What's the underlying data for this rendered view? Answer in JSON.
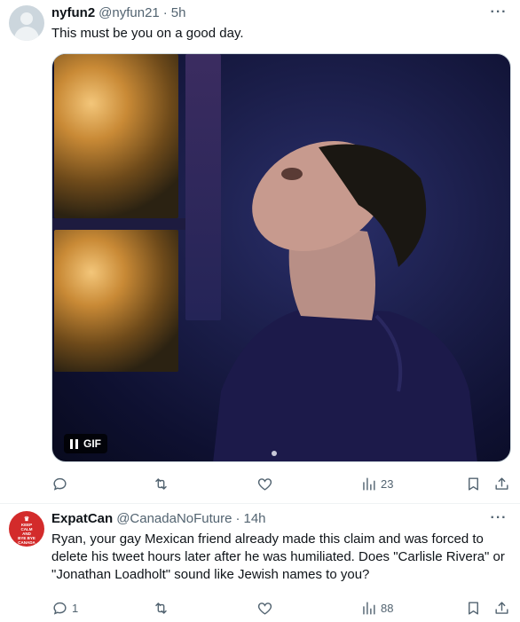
{
  "tweets": [
    {
      "name": "nyfun2",
      "handle": "@nyfun21",
      "separator": "·",
      "time": "5h",
      "text": "This must be you on a good day.",
      "media": {
        "badge": "GIF",
        "type": "animated-gif",
        "playing": true
      },
      "actions": {
        "replies": "",
        "retweets": "",
        "likes": "",
        "views": "23"
      },
      "more_icon": "more-horizontal-icon"
    },
    {
      "name": "ExpatCan",
      "handle": "@CanadaNoFuture",
      "separator": "·",
      "time": "14h",
      "avatar": {
        "lines": [
          "KEEP",
          "CALM",
          "AND",
          "BYE BYE",
          "CANADA"
        ],
        "color": "#d32b2b"
      },
      "text": "Ryan, your gay Mexican friend already made this claim and was forced to delete his tweet hours later after he was humiliated. Does \"Carlisle Rivera\" or \"Jonathan Loadholt\" sound like Jewish names to you?",
      "actions": {
        "replies": "1",
        "retweets": "",
        "likes": "",
        "views": "88"
      },
      "more_icon": "more-horizontal-icon"
    }
  ],
  "colors": {
    "text": "#0f1419",
    "secondary": "#536471",
    "divider": "#eff3f4"
  }
}
